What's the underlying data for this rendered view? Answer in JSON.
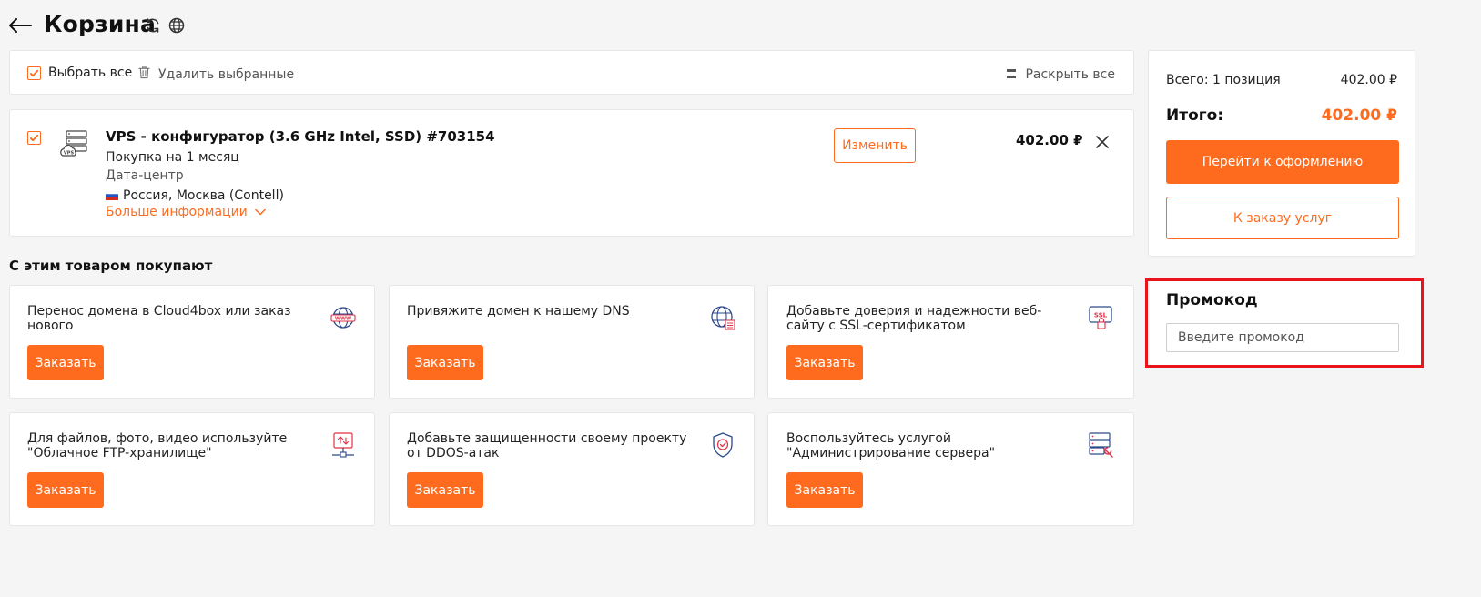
{
  "header": {
    "title": "Корзина",
    "back_icon": "arrow-left-icon",
    "refresh_icon": "refresh-icon",
    "globe_icon": "globe-icon"
  },
  "colors": {
    "accent": "#ff6b1e",
    "highlight_border": "#e8141a",
    "background": "#f5f5f5"
  },
  "toolbar": {
    "select_all_label": "Выбрать все",
    "select_all_checked": true,
    "delete_selected_label": "Удалить выбранные",
    "expand_all_label": "Раскрыть все"
  },
  "cart_item": {
    "title": "VPS - конфигуратор (3.6 GHz Intel, SSD) #703154",
    "purchase": "Покупка на 1 месяц",
    "datacenter_label": "Дата-центр",
    "datacenter_value": "Россия, Москва (Contell)",
    "more_info": "Больше информации",
    "edit_label": "Изменить",
    "price": "402.00 ₽",
    "checked": true,
    "icon": "vps-server-icon"
  },
  "upsell": {
    "title": "С этим товаром покупают",
    "cards": [
      {
        "text": "Перенос домена в Cloud4box или заказ нового",
        "button": "Заказать",
        "icon": "www-globe-icon"
      },
      {
        "text": "Привяжите домен к нашему DNS",
        "button": "Заказать",
        "icon": "dns-globe-icon"
      },
      {
        "text": "Добавьте доверия и надежности веб-сайту с SSL-сертификатом",
        "button": "Заказать",
        "icon": "ssl-certificate-icon"
      },
      {
        "text": "Для файлов, фото, видео используйте \"Облачное FTP-хранилище\"",
        "button": "Заказать",
        "icon": "ftp-storage-icon"
      },
      {
        "text": "Добавьте защищенности своему проекту от DDOS-атак",
        "button": "Заказать",
        "icon": "shield-icon"
      },
      {
        "text": "Воспользуйтесь услугой \"Администрирование сервера\"",
        "button": "Заказать",
        "icon": "server-admin-icon"
      }
    ]
  },
  "summary": {
    "positions_label": "Всего: 1 позиция",
    "positions_value": "402.00 ₽",
    "total_label": "Итого:",
    "total_value": "402.00 ₽",
    "checkout_label": "Перейти к оформлению",
    "services_label": "К заказу услуг"
  },
  "promo": {
    "title": "Промокод",
    "placeholder": "Введите промокод",
    "value": ""
  }
}
